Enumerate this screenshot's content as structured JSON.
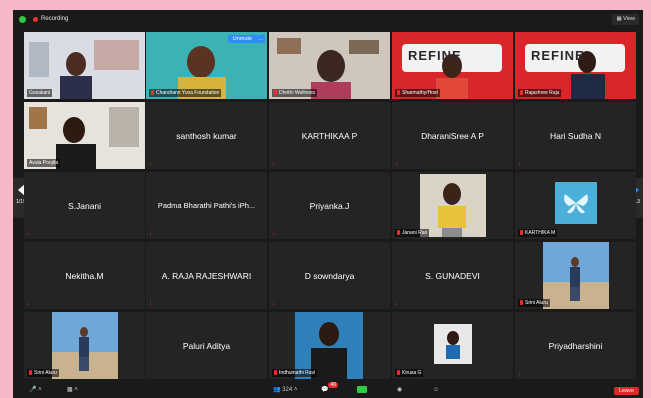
{
  "app": {
    "recording_label": "Recording",
    "view_label": "View"
  },
  "nav": {
    "left_page": "1/19",
    "right_page": "1/13"
  },
  "tiles": {
    "t0": {
      "name": "Gosakani"
    },
    "t1": {
      "name": "Chandrans Yuva Foundation",
      "unmute": "Unmute",
      "more": "..."
    },
    "t2": {
      "name": "Dhrithi Wellness"
    },
    "t3": {
      "name": "Sharmathy/Host",
      "banner": "REFINE"
    },
    "t4": {
      "name": "Rajashree Raju",
      "banner": "REFINE"
    },
    "t5": {
      "name": "Avula Poojita"
    },
    "t6": {
      "name": "santhosh kumar"
    },
    "t7": {
      "name": "KARTHIKAA P"
    },
    "t8": {
      "name": "DharaniSree A P"
    },
    "t9": {
      "name": "Hari Sudha N"
    },
    "t10": {
      "name": "S.Janani"
    },
    "t11": {
      "name": "Padma Bharathi Pathi's iPh..."
    },
    "t12": {
      "name": "Priyanka.J"
    },
    "t13": {
      "name": "Janani Rao"
    },
    "t14": {
      "name": "KARTHIKA M"
    },
    "t15": {
      "name": "Nekitha.M"
    },
    "t16": {
      "name": "A. RAJA RAJESHWARI"
    },
    "t17": {
      "name": "D sowndarya"
    },
    "t18": {
      "name": "S. GUNADEVI"
    },
    "t19": {
      "name": "Srini Aluru"
    },
    "t20": {
      "name": "Srini Aluru"
    },
    "t21": {
      "name": "Paluri Aditya"
    },
    "t22": {
      "name": "Indhumathi Ravi"
    },
    "t23": {
      "name": "Kirusa G"
    },
    "t24": {
      "name": "Priyadharshini"
    }
  },
  "toolbar": {
    "participants_count": "324",
    "chat_badge": "40",
    "leave_label": "Leave"
  },
  "colors": {
    "accent": "#2d8cff",
    "record": "#e8312f",
    "active_outline": "#e5e04a",
    "leave": "#e02828",
    "background": "#f5b8c8"
  }
}
